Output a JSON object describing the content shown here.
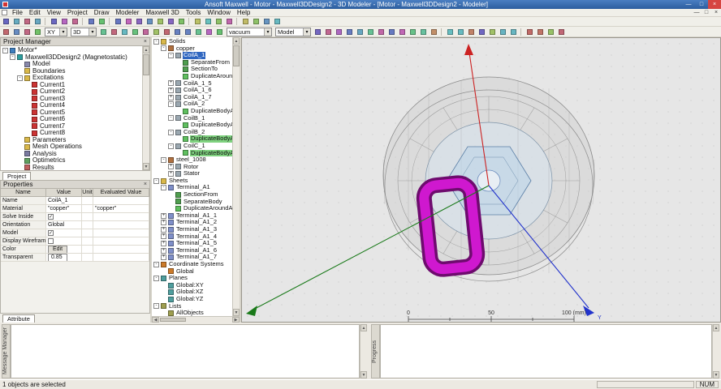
{
  "window": {
    "title": "Ansoft Maxwell - Motor - Maxwell3DDesign2 - 3D Modeler - [Motor - Maxwell3DDesign2 - Modeler]"
  },
  "menus": [
    "File",
    "Edit",
    "View",
    "Project",
    "Draw",
    "Modeler",
    "Maxwell 3D",
    "Tools",
    "Window",
    "Help"
  ],
  "toolbars": {
    "plane_value": "XY",
    "mode_value": "3D",
    "material_value": "vacuum",
    "model_value": "Model",
    "row1": [
      "new",
      "open",
      "save",
      "print",
      "|",
      "cut",
      "copy",
      "paste",
      "|",
      "undo",
      "redo",
      "|",
      "pan",
      "rotate-view",
      "zoom-in",
      "zoom-out",
      "zoom-window",
      "fit-all",
      "fit-selection",
      "|",
      "view-orientation",
      "grid-settings",
      "measure",
      "snap",
      "|",
      "select-object",
      "select-face",
      "deselect-all",
      "help"
    ],
    "row2_select": [
      "select-mode",
      "move-mode",
      "rotate-mode",
      "mirror-mode"
    ],
    "row2_draw": [
      "draw-line",
      "draw-spline",
      "draw-arc",
      "draw-rectangle",
      "draw-ellipse",
      "draw-circle",
      "draw-box",
      "draw-cylinder",
      "draw-sphere",
      "draw-torus",
      "draw-helix",
      "draw-polyhedron"
    ],
    "row2_ops": [
      "unite",
      "subtract",
      "intersect",
      "split",
      "duplicate-along-line",
      "duplicate-around-axis",
      "mirror-duplicate",
      "offset",
      "sweep",
      "thicken",
      "section",
      "connect",
      "|",
      "validate",
      "analyze-all",
      "solutions",
      "field-overlays",
      "mesh-plot",
      "optimetrics-setup",
      "output-variables",
      "|",
      "local-cs",
      "relative-cs",
      "face-cs",
      "object-cs"
    ]
  },
  "project_manager": {
    "title": "Project Manager",
    "tab": "Project",
    "tree": [
      {
        "label": "Motor*",
        "icon": "project",
        "children": [
          {
            "label": "Maxwell3DDesign2 (Magnetostatic)",
            "icon": "design",
            "children": [
              {
                "label": "Model",
                "icon": "model"
              },
              {
                "label": "Boundaries",
                "icon": "folder"
              },
              {
                "label": "Excitations",
                "icon": "folder",
                "children": [
                  {
                    "label": "Current1",
                    "icon": "current"
                  },
                  {
                    "label": "Current2",
                    "icon": "current"
                  },
                  {
                    "label": "Current3",
                    "icon": "current"
                  },
                  {
                    "label": "Current4",
                    "icon": "current"
                  },
                  {
                    "label": "Current5",
                    "icon": "current"
                  },
                  {
                    "label": "Current6",
                    "icon": "current"
                  },
                  {
                    "label": "Current7",
                    "icon": "current"
                  },
                  {
                    "label": "Current8",
                    "icon": "current"
                  }
                ]
              },
              {
                "label": "Parameters",
                "icon": "folder"
              },
              {
                "label": "Mesh Operations",
                "icon": "folder"
              },
              {
                "label": "Analysis",
                "icon": "analysis"
              },
              {
                "label": "Optimetrics",
                "icon": "optimetrics"
              },
              {
                "label": "Results",
                "icon": "results"
              }
            ]
          }
        ]
      }
    ]
  },
  "properties": {
    "title": "Properties",
    "tab": "Attribute",
    "columns": [
      "Name",
      "Value",
      "Unit",
      "Evaluated Value"
    ],
    "rows": [
      {
        "label": "Name",
        "type": "text",
        "value": "CoilA_1",
        "unit": "",
        "evaluated": ""
      },
      {
        "label": "Material",
        "type": "text",
        "value": "\"copper\"",
        "unit": "",
        "evaluated": "\"copper\""
      },
      {
        "label": "Solve Inside",
        "type": "check-on",
        "value": "",
        "unit": "",
        "evaluated": ""
      },
      {
        "label": "Orientation",
        "type": "text",
        "value": "Global",
        "unit": "",
        "evaluated": ""
      },
      {
        "label": "Model",
        "type": "check-on",
        "value": "",
        "unit": "",
        "evaluated": ""
      },
      {
        "label": "Display Wireframe",
        "type": "check-off",
        "value": "",
        "unit": "",
        "evaluated": ""
      },
      {
        "label": "Color",
        "type": "button",
        "value": "Edit",
        "unit": "",
        "evaluated": ""
      },
      {
        "label": "Transparent",
        "type": "field",
        "value": "0.85",
        "unit": "",
        "evaluated": ""
      }
    ]
  },
  "model_tree": [
    {
      "label": "Solids",
      "icon": "group",
      "children": [
        {
          "label": "copper",
          "icon": "material",
          "children": [
            {
              "label": "CoilA_1",
              "icon": "solid",
              "selected": true,
              "children": [
                {
                  "label": "SeparateFrom",
                  "icon": "op"
                },
                {
                  "label": "SectionTo",
                  "icon": "op"
                },
                {
                  "label": "DuplicateAroundAxis",
                  "icon": "op-dup"
                }
              ]
            },
            {
              "label": "CoilA_1_5",
              "icon": "solid",
              "expanded": false,
              "children": []
            },
            {
              "label": "CoilA_1_6",
              "icon": "solid",
              "expanded": false,
              "children": []
            },
            {
              "label": "CoilA_1_7",
              "icon": "solid",
              "expanded": false,
              "children": []
            },
            {
              "label": "CoilA_2",
              "icon": "solid",
              "children": [
                {
                  "label": "DuplicateBodyAroundAxi",
                  "icon": "op-dup"
                }
              ]
            },
            {
              "label": "CoilB_1",
              "icon": "solid",
              "children": [
                {
                  "label": "DuplicateBodyAroundAxi",
                  "icon": "op-dup"
                }
              ]
            },
            {
              "label": "CoilB_2",
              "icon": "solid",
              "children": [
                {
                  "label": "DuplicateBodyAroundAxi",
                  "icon": "op-dup",
                  "highlight": true
                }
              ]
            },
            {
              "label": "CoilC_1",
              "icon": "solid",
              "children": [
                {
                  "label": "DuplicateBodyAroundAxi",
                  "icon": "op-dup",
                  "highlight": true
                }
              ]
            }
          ]
        },
        {
          "label": "steel_1008",
          "icon": "material",
          "children": [
            {
              "label": "Rotor",
              "icon": "solid",
              "expanded": false,
              "children": []
            },
            {
              "label": "Stator",
              "icon": "solid",
              "expanded": false,
              "children": []
            }
          ]
        }
      ]
    },
    {
      "label": "Sheets",
      "icon": "group",
      "children": [
        {
          "label": "Terminal_A1",
          "icon": "sheet",
          "children": [
            {
              "label": "SectionFrom",
              "icon": "op"
            },
            {
              "label": "SeparateBody",
              "icon": "op"
            },
            {
              "label": "DuplicateAroundAxis",
              "icon": "op-dup"
            }
          ]
        },
        {
          "label": "Terminal_A1_1",
          "icon": "sheet",
          "expanded": false,
          "children": []
        },
        {
          "label": "Terminal_A1_2",
          "icon": "sheet",
          "expanded": false,
          "children": []
        },
        {
          "label": "Terminal_A1_3",
          "icon": "sheet",
          "expanded": false,
          "children": []
        },
        {
          "label": "Terminal_A1_4",
          "icon": "sheet",
          "expanded": false,
          "children": []
        },
        {
          "label": "Terminal_A1_5",
          "icon": "sheet",
          "expanded": false,
          "children": []
        },
        {
          "label": "Terminal_A1_6",
          "icon": "sheet",
          "expanded": false,
          "children": []
        },
        {
          "label": "Terminal_A1_7",
          "icon": "sheet",
          "expanded": false,
          "children": []
        }
      ]
    },
    {
      "label": "Coordinate Systems",
      "icon": "cs",
      "children": [
        {
          "label": "Global",
          "icon": "cs"
        }
      ]
    },
    {
      "label": "Planes",
      "icon": "plane",
      "children": [
        {
          "label": "Global:XY",
          "icon": "plane"
        },
        {
          "label": "Global:XZ",
          "icon": "plane"
        },
        {
          "label": "Global:YZ",
          "icon": "plane"
        }
      ]
    },
    {
      "label": "Lists",
      "icon": "list",
      "children": [
        {
          "label": "AllObjects",
          "icon": "list"
        }
      ]
    }
  ],
  "viewport": {
    "scale_ticks": [
      "0",
      "50",
      "100 (mm)"
    ],
    "axis_label_y": "Y"
  },
  "bottom": {
    "message_label": "Message Manager",
    "progress_label": "Progress"
  },
  "status": {
    "selection": "1 objects are selected",
    "num": "NUM"
  }
}
